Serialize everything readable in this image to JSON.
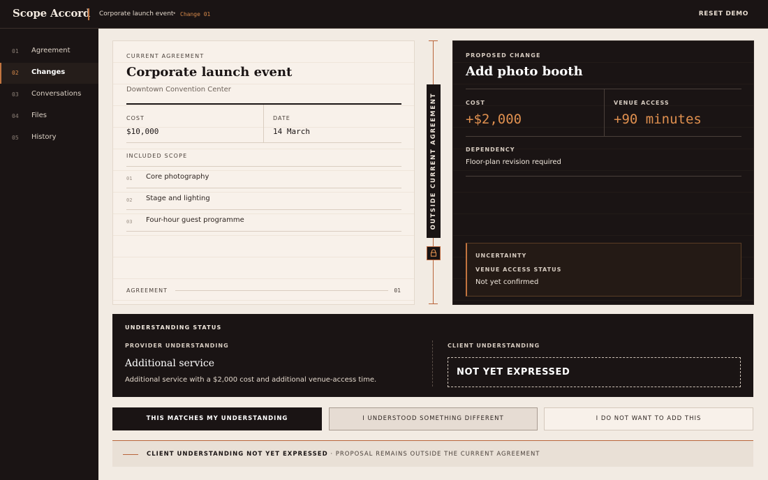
{
  "app": {
    "brand": "Scope Accord",
    "breadcrumb": {
      "event": "Corporate launch event",
      "separator": "•",
      "change": "Change 01"
    },
    "reset_label": "RESET DEMO"
  },
  "sidebar": {
    "items": [
      {
        "num": "01",
        "label": "Agreement",
        "active": false
      },
      {
        "num": "02",
        "label": "Changes",
        "active": true
      },
      {
        "num": "03",
        "label": "Conversations",
        "active": false
      },
      {
        "num": "04",
        "label": "Files",
        "active": false
      },
      {
        "num": "05",
        "label": "History",
        "active": false
      }
    ]
  },
  "agreement": {
    "eyebrow": "CURRENT AGREEMENT",
    "title": "Corporate launch event",
    "venue": "Downtown Convention Center",
    "cost_label": "COST",
    "cost_value": "$10,000",
    "date_label": "DATE",
    "date_value": "14 March",
    "scope_label": "INCLUDED SCOPE",
    "scope_items": [
      {
        "num": "01",
        "text": "Core photography"
      },
      {
        "num": "02",
        "text": "Stage and lighting"
      },
      {
        "num": "03",
        "text": "Four-hour guest programme"
      }
    ],
    "footer_label": "AGREEMENT",
    "footer_num": "01"
  },
  "connector": {
    "label": "OUTSIDE CURRENT AGREEMENT",
    "icon": "lock-icon"
  },
  "proposal": {
    "eyebrow": "PROPOSED CHANGE",
    "title": "Add photo booth",
    "cost_label": "COST",
    "cost_value": "+$2,000",
    "access_label": "VENUE ACCESS",
    "access_value": "+90 minutes",
    "dependency_label": "DEPENDENCY",
    "dependency_value": "Floor-plan revision required",
    "uncertainty": {
      "label": "UNCERTAINTY",
      "sub_label": "VENUE ACCESS STATUS",
      "value": "Not yet confirmed"
    }
  },
  "status": {
    "title": "UNDERSTANDING STATUS",
    "provider_label": "PROVIDER UNDERSTANDING",
    "provider_title": "Additional service",
    "provider_desc": "Additional service with a $2,000 cost and additional venue-access time.",
    "client_label": "CLIENT UNDERSTANDING",
    "client_value": "NOT YET EXPRESSED"
  },
  "actions": {
    "matches": "THIS MATCHES MY UNDERSTANDING",
    "different": "I UNDERSTOOD SOMETHING DIFFERENT",
    "decline": "I DO NOT WANT TO ADD THIS"
  },
  "banner": {
    "strong": "CLIENT UNDERSTANDING NOT YET EXPRESSED",
    "rest": " · PROPOSAL REMAINS OUTSIDE THE CURRENT AGREEMENT"
  },
  "colors": {
    "dark": "#1a1414",
    "accent": "#c2743f",
    "accent_text": "#e0904f",
    "paper": "#f8f1ea",
    "background": "#f2ebe3"
  }
}
